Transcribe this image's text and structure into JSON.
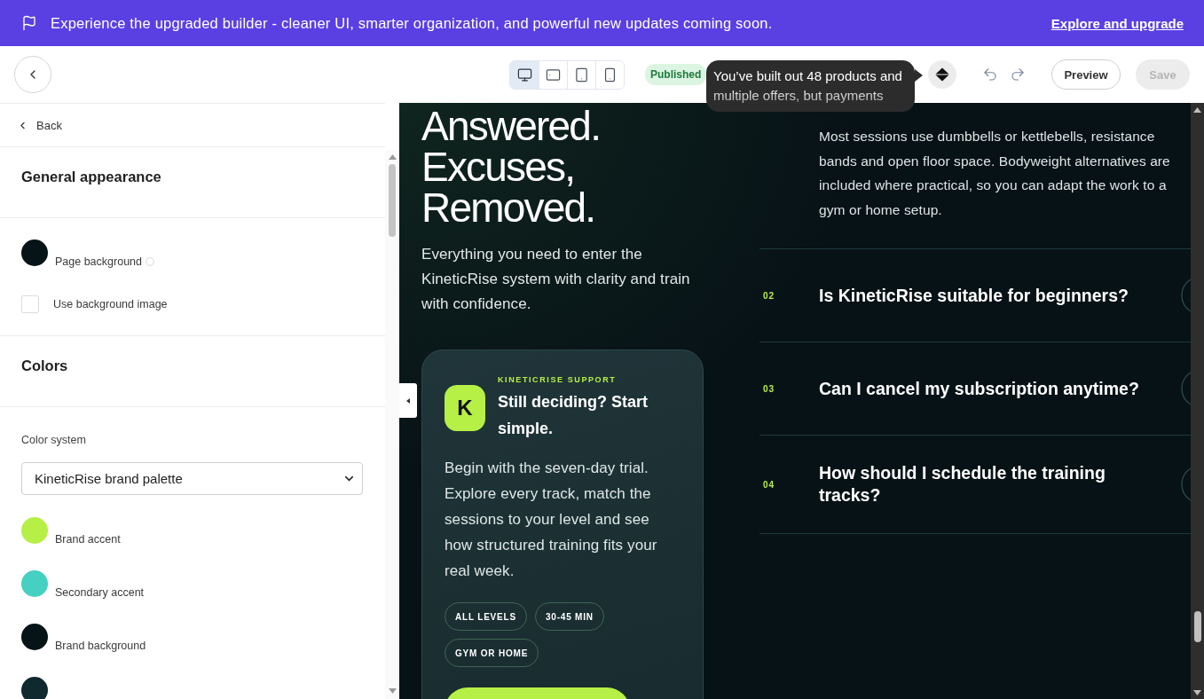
{
  "banner": {
    "message": "Experience the upgraded builder - cleaner UI, smarter organization, and powerful new updates coming soon.",
    "link": "Explore and upgrade"
  },
  "toolbar": {
    "devices": [
      {
        "kind": "desktop",
        "selected": true
      },
      {
        "kind": "tablet_landscape",
        "selected": false
      },
      {
        "kind": "tablet",
        "selected": false
      },
      {
        "kind": "phone",
        "selected": false
      }
    ],
    "status": "Published",
    "tooltip": "You’ve built out 48 products and multiple offers, but payments",
    "preview": "Preview",
    "save": {
      "label": "Save",
      "disabled": true
    }
  },
  "sidebar": {
    "back": "Back",
    "general": {
      "title": "General appearance",
      "page_background": {
        "label": "Page background",
        "color": "#061317"
      },
      "background_image": {
        "label": "Use background image",
        "checked": false
      }
    },
    "colors": {
      "title": "Colors",
      "system_label": "Color system",
      "system_value": "KineticRise brand palette",
      "swatches": [
        {
          "label": "Brand accent",
          "color": "#b6ef45"
        },
        {
          "label": "Secondary accent",
          "color": "#45d0c1"
        },
        {
          "label": "Brand background",
          "color": "#061317"
        },
        {
          "color": "#10292f"
        }
      ]
    }
  },
  "preview": {
    "hero": {
      "title": "Answered. Excuses, Removed.",
      "intro": "Everything you need to enter the KineticRise system with clarity and train with confidence."
    },
    "support_card": {
      "avatar": "K",
      "eyebrow": "KINETICRISE SUPPORT",
      "title": "Still deciding? Start simple.",
      "body": "Begin with the seven-day trial. Explore every track, match the sessions to your level and see how structured training fits your real week.",
      "tags": [
        "ALL LEVELS",
        "30-45 MIN",
        "GYM OR HOME"
      ]
    },
    "faq": {
      "open_answer": "Most sessions use dumbbells or kettlebells, resistance bands and open floor space. Bodyweight alternatives are included where practical, so you can adapt the work to a gym or home setup.",
      "items": [
        {
          "number": "02",
          "question": "Is KineticRise suitable for beginners?"
        },
        {
          "number": "03",
          "question": "Can I cancel my subscription anytime?"
        },
        {
          "number": "04",
          "question": "How should I schedule the training tracks?"
        }
      ]
    }
  }
}
